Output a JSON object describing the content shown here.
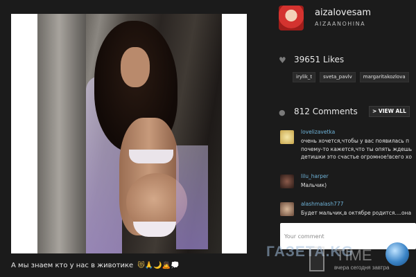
{
  "post": {
    "caption": "А мы знаем кто у нас в животике",
    "caption_emoji": "😻🙏🌙🙇💭"
  },
  "profile": {
    "username": "aizalovesam",
    "fullname": "AIZAANOHINA"
  },
  "likes": {
    "icon": "heart-icon",
    "count_label": "39651 Likes",
    "likers": [
      "irylik_t",
      "sveta_pavlv",
      "margaritakozlova"
    ]
  },
  "comments": {
    "icon": "comment-icon",
    "count_label": "812 Comments",
    "view_all_label": "> VIEW ALL",
    "items": [
      {
        "user": "lovelizavetka",
        "lines": [
          "очень хочется,чтобы у вас появилась п",
          "почему-то кажется,что ты опять ждешь",
          "детишки это счастье огромное!всего хо"
        ]
      },
      {
        "user": "lilu_harper",
        "lines": [
          "Мальчик)"
        ]
      },
      {
        "user": "alashmalash777",
        "lines": [
          "Будет мальчик,в октябре родится....она"
        ]
      }
    ],
    "input_placeholder": "Your comment"
  },
  "watermark": {
    "text": "ГАЗЕТА.KG",
    "time_text": "TIME",
    "subtitle": "вчера сегодня завтра"
  }
}
